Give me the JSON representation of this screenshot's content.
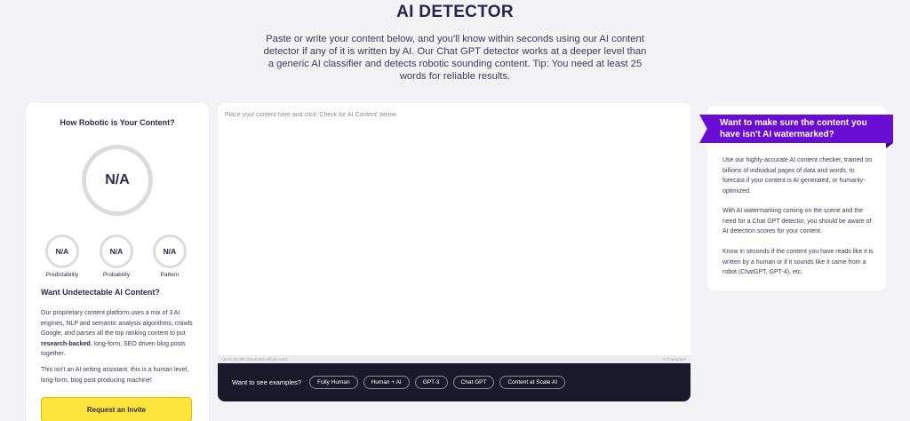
{
  "header": {
    "title": "AI DETECTOR",
    "intro": "Paste or write your content below, and you'll know within seconds using our AI content detector if any of it is written by AI. Our Chat GPT detector works at a deeper level than a generic AI classifier and detects robotic sounding content. Tip: You need at least 25 words for reliable results."
  },
  "score_card": {
    "title": "How Robotic is Your Content?",
    "overall": "N/A",
    "metrics": [
      {
        "value": "N/A",
        "label": "Predictability"
      },
      {
        "value": "N/A",
        "label": "Probability"
      },
      {
        "value": "N/A",
        "label": "Pattern"
      }
    ],
    "promo_heading": "Want Undetectable AI Content?",
    "promo_p1_start": "Our proprietary content platform uses a mix of 3 AI engines, NLP and semantic analysis algorithms, crawls Google, and parses all the top ranking content to put ",
    "promo_p1_bold": "research-backed",
    "promo_p1_end": ", long-form, SEO driven blog posts together.",
    "promo_p2": "This isn't an AI writing assistant, this is a human level, long-form, blog post producing machine!",
    "invite_button": "Request an Invite"
  },
  "editor": {
    "placeholder": "Place your content here and click 'Check for AI Content' below.",
    "limit_note": "Up to 25,000 characters will be used.",
    "char_count": "0 Characters",
    "examples_label": "Want to see examples?",
    "examples": [
      "Fully Human",
      "Human + AI",
      "GPT-3",
      "Chat GPT",
      "Content at Scale AI"
    ]
  },
  "info_card": {
    "ribbon": "Want to make sure the content you have isn't AI watermarked?",
    "p1": "Use our highly-accurate AI content checker, trained on billions of individual pages of data and words, to forecast if your content is AI generated, or humanly-optimized.",
    "p2": "With AI watermarking coming on the scene and the need for a Chat GPT detector, you should be aware of AI detection scores for your content.",
    "p3": "Know in seconds if the content you have reads like it is written by a human or if it sounds like it came from a robot (ChatGPT, GPT-4), etc."
  },
  "colors": {
    "accent_purple": "#6a0dd4",
    "button_yellow": "#ffe53b",
    "dark_bar": "#1a1929",
    "text_dark": "#2d2a4a"
  }
}
